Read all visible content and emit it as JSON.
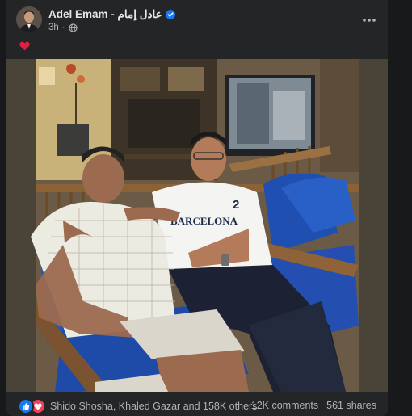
{
  "post": {
    "author_name": "Adel Emam - عادل إمام",
    "timestamp": "3h",
    "privacy_icon": "globe-icon",
    "verified_icon": "verified-badge-icon",
    "more_icon": "more-options-icon",
    "text_icon": "red-heart-icon"
  },
  "photo": {
    "shirt_text": "BARCELONA",
    "shirt_number": "2"
  },
  "footer": {
    "reaction_icons": [
      "like-icon",
      "love-icon"
    ],
    "reactions_text": "Shido Shosha, Khaled Gazar and 158K others",
    "comments": "12K comments",
    "shares": "561 shares"
  },
  "colors": {
    "background": "#18191a",
    "card": "#242526",
    "text_primary": "#e4e6eb",
    "text_secondary": "#b0b3b8",
    "like_blue": "#1877f2",
    "love_red": "#f33e58",
    "heart_red": "#e41e3f"
  }
}
